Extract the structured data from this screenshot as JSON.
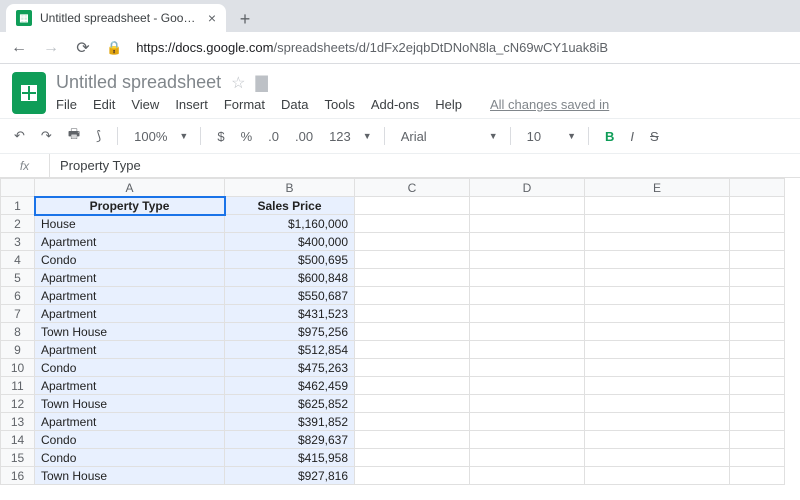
{
  "browser": {
    "tab_title": "Untitled spreadsheet - Google Sh",
    "url_host": "https://docs.google.com",
    "url_path": "/spreadsheets/d/1dFx2ejqbDtDNoN8la_cN69wCY1uak8iB"
  },
  "doc": {
    "title": "Untitled spreadsheet",
    "changes": "All changes saved in"
  },
  "menubar": {
    "file": "File",
    "edit": "Edit",
    "view": "View",
    "insert": "Insert",
    "format": "Format",
    "data": "Data",
    "tools": "Tools",
    "addons": "Add-ons",
    "help": "Help"
  },
  "toolbar": {
    "zoom": "100%",
    "currency": "$",
    "percent": "%",
    "dec_less": ".0",
    "dec_more": ".00",
    "numfmt": "123",
    "font": "Arial",
    "fontsize": "10",
    "bold": "B",
    "italic": "I",
    "strike": "S"
  },
  "formula": {
    "label": "fx",
    "value": "Property Type"
  },
  "columns": [
    "A",
    "B",
    "C",
    "D",
    "E"
  ],
  "headers": {
    "A": "Property Type",
    "B": "Sales Price"
  },
  "rows": [
    {
      "A": "House",
      "B": "$1,160,000"
    },
    {
      "A": "Apartment",
      "B": "$400,000"
    },
    {
      "A": "Condo",
      "B": "$500,695"
    },
    {
      "A": "Apartment",
      "B": "$600,848"
    },
    {
      "A": "Apartment",
      "B": "$550,687"
    },
    {
      "A": "Apartment",
      "B": "$431,523"
    },
    {
      "A": "Town House",
      "B": "$975,256"
    },
    {
      "A": "Apartment",
      "B": "$512,854"
    },
    {
      "A": "Condo",
      "B": "$475,263"
    },
    {
      "A": "Apartment",
      "B": "$462,459"
    },
    {
      "A": "Town House",
      "B": "$625,852"
    },
    {
      "A": "Apartment",
      "B": "$391,852"
    },
    {
      "A": "Condo",
      "B": "$829,637"
    },
    {
      "A": "Condo",
      "B": "$415,958"
    },
    {
      "A": "Town House",
      "B": "$927,816"
    }
  ]
}
